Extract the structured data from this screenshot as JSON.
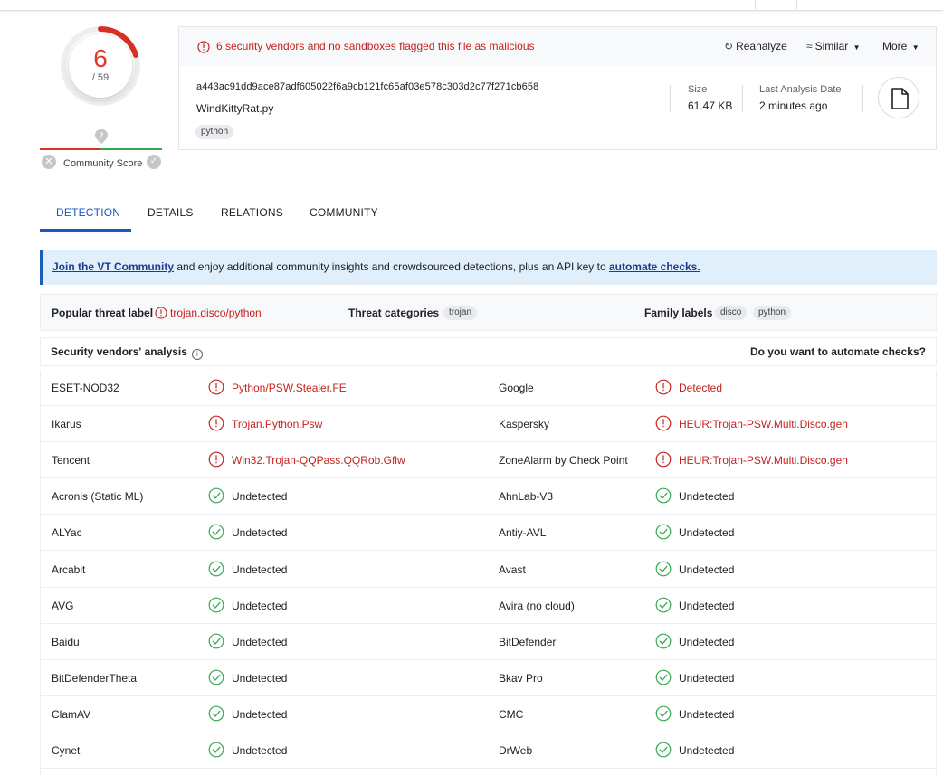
{
  "score": {
    "detections": "6",
    "total": "/ 59"
  },
  "community": {
    "label": "Community Score",
    "marker_icon": "question-location-icon"
  },
  "header": {
    "alert": "6 security vendors and no sandboxes flagged this file as malicious",
    "actions": {
      "reanalyze": "Reanalyze",
      "similar": "Similar",
      "more": "More"
    },
    "hash": "a443ac91dd9ace87adf605022f6a9cb121fc65af03e578c303d2c77f271cb658",
    "filename": "WindKittyRat.py",
    "tag": "python",
    "size_label": "Size",
    "size_value": "61.47 KB",
    "date_label": "Last Analysis Date",
    "date_value": "2 minutes ago"
  },
  "tabs": [
    "DETECTION",
    "DETAILS",
    "RELATIONS",
    "COMMUNITY"
  ],
  "banner": {
    "link1": "Join the VT Community",
    "text": " and enjoy additional community insights and crowdsourced detections, plus an API key to ",
    "link2": "automate checks."
  },
  "threat": {
    "popular_label": "Popular threat label",
    "popular_value": "trojan.disco/python",
    "categories_label": "Threat categories",
    "categories": [
      "trojan"
    ],
    "family_label": "Family labels",
    "families": [
      "disco",
      "python"
    ]
  },
  "vendors_header": {
    "left": "Security vendors' analysis",
    "right": "Do you want to automate checks?"
  },
  "colors": {
    "malicious": "#c5221f",
    "clean": "#34a853",
    "accent": "#1a56c4"
  },
  "vendors": [
    {
      "left_name": "ESET-NOD32",
      "left_result": "Python/PSW.Stealer.FE",
      "left_bad": true,
      "right_name": "Google",
      "right_result": "Detected",
      "right_bad": true
    },
    {
      "left_name": "Ikarus",
      "left_result": "Trojan.Python.Psw",
      "left_bad": true,
      "right_name": "Kaspersky",
      "right_result": "HEUR:Trojan-PSW.Multi.Disco.gen",
      "right_bad": true
    },
    {
      "left_name": "Tencent",
      "left_result": "Win32.Trojan-QQPass.QQRob.Gflw",
      "left_bad": true,
      "right_name": "ZoneAlarm by Check Point",
      "right_result": "HEUR:Trojan-PSW.Multi.Disco.gen",
      "right_bad": true
    },
    {
      "left_name": "Acronis (Static ML)",
      "left_result": "Undetected",
      "left_bad": false,
      "right_name": "AhnLab-V3",
      "right_result": "Undetected",
      "right_bad": false
    },
    {
      "left_name": "ALYac",
      "left_result": "Undetected",
      "left_bad": false,
      "right_name": "Antiy-AVL",
      "right_result": "Undetected",
      "right_bad": false
    },
    {
      "left_name": "Arcabit",
      "left_result": "Undetected",
      "left_bad": false,
      "right_name": "Avast",
      "right_result": "Undetected",
      "right_bad": false
    },
    {
      "left_name": "AVG",
      "left_result": "Undetected",
      "left_bad": false,
      "right_name": "Avira (no cloud)",
      "right_result": "Undetected",
      "right_bad": false
    },
    {
      "left_name": "Baidu",
      "left_result": "Undetected",
      "left_bad": false,
      "right_name": "BitDefender",
      "right_result": "Undetected",
      "right_bad": false
    },
    {
      "left_name": "BitDefenderTheta",
      "left_result": "Undetected",
      "left_bad": false,
      "right_name": "Bkav Pro",
      "right_result": "Undetected",
      "right_bad": false
    },
    {
      "left_name": "ClamAV",
      "left_result": "Undetected",
      "left_bad": false,
      "right_name": "CMC",
      "right_result": "Undetected",
      "right_bad": false
    },
    {
      "left_name": "Cynet",
      "left_result": "Undetected",
      "left_bad": false,
      "right_name": "DrWeb",
      "right_result": "Undetected",
      "right_bad": false
    }
  ]
}
